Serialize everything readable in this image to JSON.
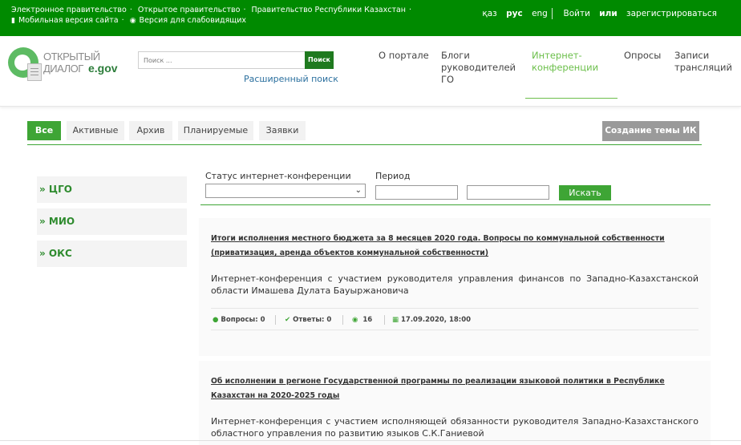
{
  "topbar": {
    "links_row1": [
      "Электронное правительство",
      "Открытое правительство",
      "Правительство Республики Казахстан"
    ],
    "mobile": "Мобильная версия сайта",
    "accessible": "Версия для слабовидящих",
    "lang": [
      "қаз",
      "рус",
      "eng"
    ],
    "login": "Войти",
    "or": "или",
    "register": "зарегистрироваться"
  },
  "header": {
    "logo_line1": "ОТКРЫТЫЙ",
    "logo_line2": "ДИАЛОГ",
    "logo_egov": "e.gov",
    "search_placeholder": "Поиск ...",
    "search_button": "Поиск",
    "advanced_search": "Расширенный поиск",
    "nav": [
      {
        "label": "О портале"
      },
      {
        "label": "Блоги руководителей ГО"
      },
      {
        "label": "Интернет-конференции"
      },
      {
        "label": "Опросы"
      },
      {
        "label": "Записи трансляций"
      }
    ]
  },
  "tabs": [
    "Все",
    "Активные",
    "Архив",
    "Планируемые",
    "Заявки"
  ],
  "create_button": "Создание темы ИК",
  "sidebar": [
    "» ЦГО",
    "» МИО",
    "» ОКС"
  ],
  "filter": {
    "status_label": "Статус интернет-конференции",
    "period_label": "Период",
    "search_button": "Искать"
  },
  "cards": [
    {
      "title": "Итоги исполнения местного бюджета за 8 месяцев 2020 года. Вопросы по коммунальной собственности (приватизация, аренда объектов коммунальной собственности)",
      "desc": "Интернет-конференция с участием руководителя управления финансов по Западно-Казахстанской области Имашева Дулата Бауыржановича",
      "questions": "Вопросы: 0",
      "answers": "Ответы: 0",
      "views": "16",
      "date": "17.09.2020, 18:00"
    },
    {
      "title": "Об исполнении в регионе Государственной программы по реализации языковой политики в Республике Казахстан на 2020-2025 годы",
      "desc": "Интернет-конференция с участием исполняющей обязанности руководителя Западно-Казахстанского областного управления по развитию языков С.К.Ганиевой"
    }
  ],
  "colors": {
    "topbar": "#008a00",
    "accent": "#3ea535",
    "nav_active": "#6cbf4b"
  }
}
